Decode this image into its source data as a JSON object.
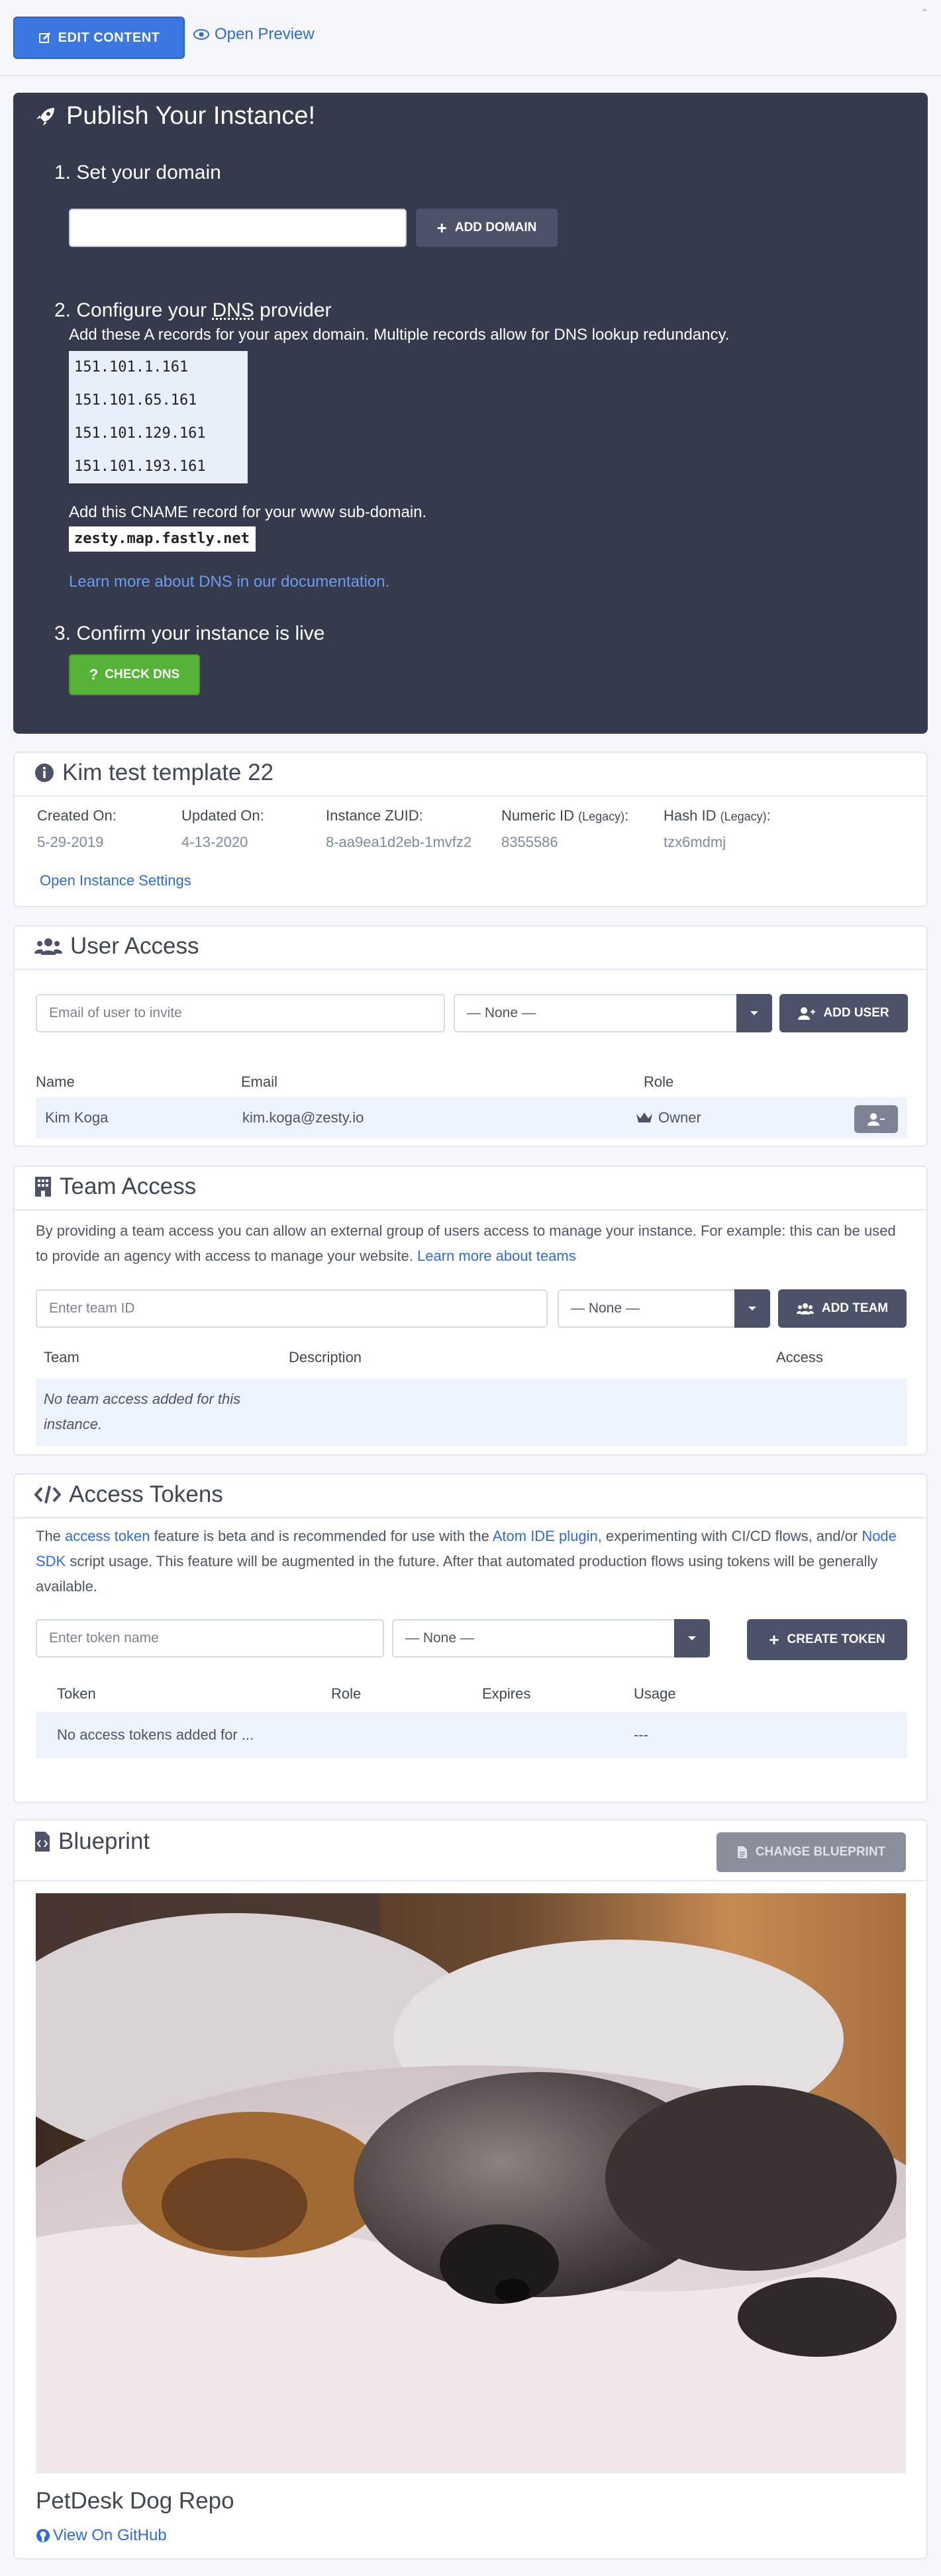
{
  "topbar": {
    "edit_label": "EDIT CONTENT",
    "preview_label": "Open Preview"
  },
  "publish": {
    "title": "Publish Your Instance!",
    "step1": "1. Set your domain",
    "domain_value": "",
    "add_domain": "ADD DOMAIN",
    "step2_prefix": "2. Configure your ",
    "step2_abbr": "DNS",
    "step2_suffix": " provider",
    "a_records_text": "Add these A records for your apex domain. Multiple records allow for DNS lookup redundancy.",
    "a_records": [
      "151.101.1.161",
      "151.101.65.161",
      "151.101.129.161",
      "151.101.193.161"
    ],
    "cname_text": "Add this CNAME record for your www sub-domain.",
    "cname_value": "zesty.map.fastly.net",
    "docs_link": "Learn more about DNS in our documentation.",
    "step3": "3. Confirm your instance is live",
    "check_dns": "CHECK DNS"
  },
  "instance": {
    "title": "Kim test template 22",
    "created_label": "Created On:",
    "created_value": "5-29-2019",
    "updated_label": "Updated On:",
    "updated_value": "4-13-2020",
    "zuid_label": "Instance ZUID:",
    "zuid_value": "8-aa9ea1d2eb-1mvfz2",
    "numeric_label": "Numeric ID ",
    "numeric_legacy": "(Legacy)",
    "numeric_colon": ":",
    "numeric_value": "8355586",
    "hash_label": "Hash ID ",
    "hash_legacy": "(Legacy)",
    "hash_colon": ":",
    "hash_value": "tzx6mdmj",
    "settings_link": "Open Instance Settings"
  },
  "user_access": {
    "title": "User Access",
    "email_placeholder": "Email of user to invite",
    "role_select": "— None —",
    "add_user": "ADD USER",
    "headers": [
      "Name",
      "Email",
      "Role"
    ],
    "rows": [
      {
        "name": "Kim Koga",
        "email": "kim.koga@zesty.io",
        "role": "Owner"
      }
    ]
  },
  "team_access": {
    "title": "Team Access",
    "description": "By providing a team access you can allow an external group of users access to manage your instance. For example: this can be used to provide an agency with access to manage your website. ",
    "learn_more": "Learn more about teams",
    "team_placeholder": "Enter team ID",
    "role_select": "— None —",
    "add_team": "ADD TEAM",
    "headers": [
      "Team",
      "Description",
      "Access"
    ],
    "empty_text": "No team access added for this instance."
  },
  "access_tokens": {
    "title": "Access Tokens",
    "desc_1": "The ",
    "desc_link1": "access token",
    "desc_2": " feature is beta and is recommended for use with the ",
    "desc_link2": "Atom IDE plugin",
    "desc_3": ", experimenting with CI/CD flows, and/or ",
    "desc_link3": "Node SDK",
    "desc_4": " script usage. This feature will be augmented in the future. After that automated production flows using tokens will be generally available.",
    "token_placeholder": "Enter token name",
    "role_select": "— None —",
    "create_token": "CREATE TOKEN",
    "headers": [
      "Token",
      "Role",
      "Expires",
      "Usage"
    ],
    "empty_text": "No access tokens added for ...",
    "empty_usage": "---"
  },
  "blueprint": {
    "title": "Blueprint",
    "change_button": "CHANGE BLUEPRINT",
    "repo_name": "PetDesk Dog Repo",
    "github_link": "View On GitHub"
  },
  "colors": {
    "primary": "#3b77e0",
    "dark_panel": "#353a4c",
    "success": "#57b337",
    "link": "#2f6bd8"
  }
}
